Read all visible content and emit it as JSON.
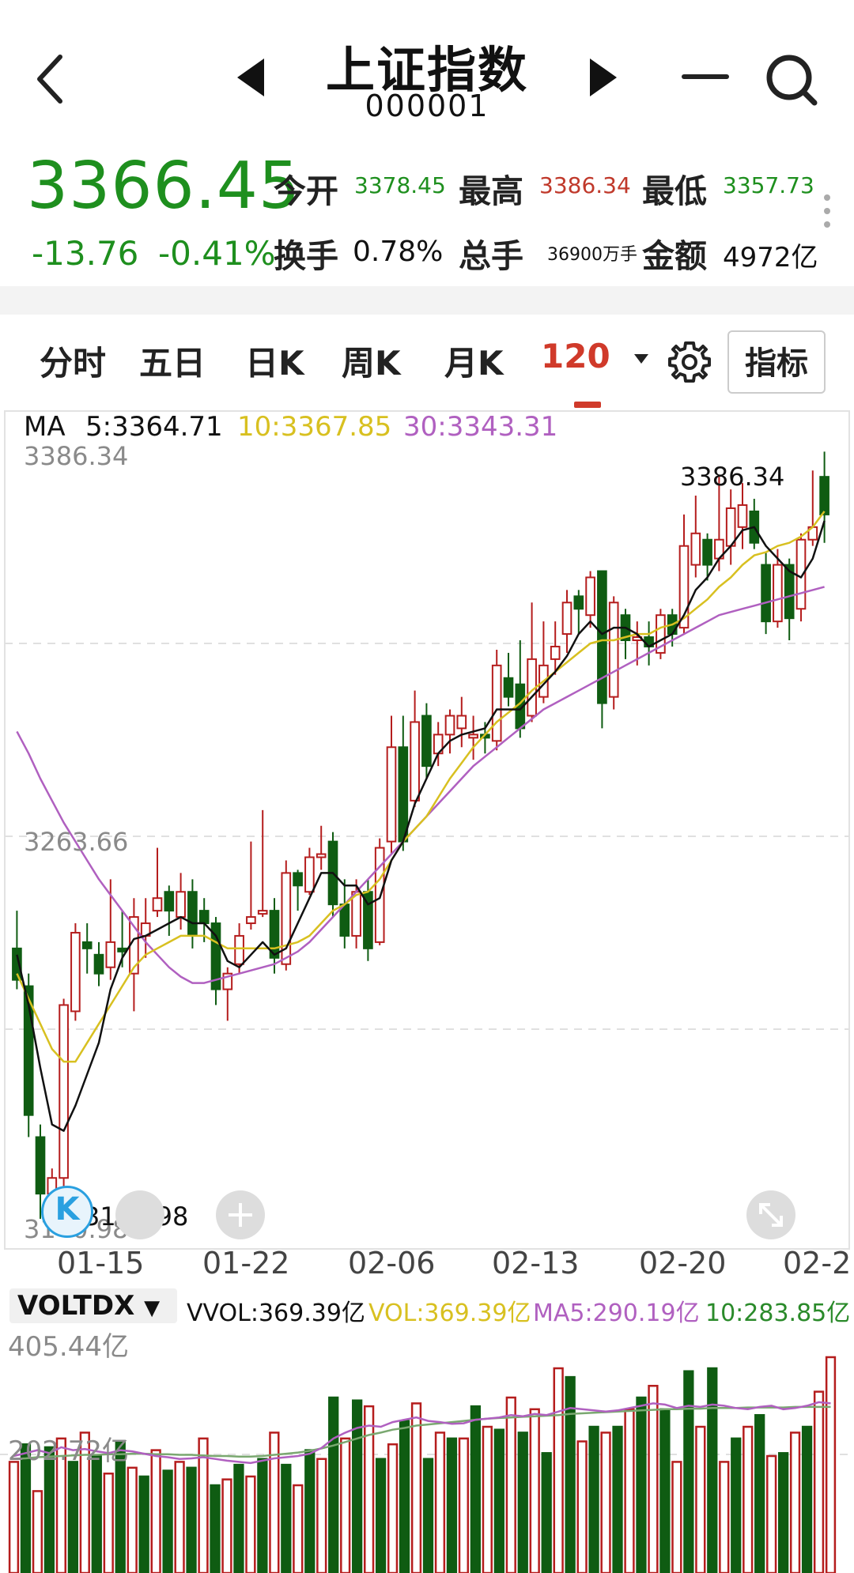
{
  "header": {
    "title": "上证指数",
    "code": "000001"
  },
  "quote": {
    "price": "3366.45",
    "change": "-13.76",
    "change_pct": "-0.41%",
    "open_label": "今开",
    "open": "3378.45",
    "high_label": "最高",
    "high": "3386.34",
    "low_label": "最低",
    "low": "3357.73",
    "turnover_label": "换手",
    "turnover": "0.78%",
    "volume_label": "总手",
    "volume": "36900万手",
    "amount_label": "金额",
    "amount": "4972亿"
  },
  "tabs": [
    "分时",
    "五日",
    "日K",
    "周K",
    "月K",
    "120"
  ],
  "active_tab": 5,
  "indicator_button": "指标",
  "ma": {
    "label": "MA",
    "ma5": "5:3364.71",
    "ma10": "10:3367.85",
    "ma30": "30:3343.31"
  },
  "price_axis": {
    "top": "3386.34",
    "mid": "3263.66",
    "bottom": "3140.98"
  },
  "annotations": {
    "high": "3386.34",
    "low": "3140.98"
  },
  "date_labels": [
    "01-15",
    "01-22",
    "02-06",
    "02-13",
    "02-20",
    "02-2"
  ],
  "volume_panel": {
    "indicator": "VOLTDX",
    "vvol": "VVOL:369.39亿",
    "vol": "VOL:369.39亿",
    "ma5": "MA5:290.19亿",
    "ma10": "10:283.85亿",
    "axis_top": "405.44亿",
    "axis_mid": "202.72亿"
  },
  "colors": {
    "up": "#b51d1d",
    "down": "#0f5c12",
    "ma5": "#111111",
    "ma10": "#d8c020",
    "ma30": "#b060c0",
    "accent": "#d03a2a",
    "price_green": "#1e8f1e"
  },
  "chart_data": {
    "type": "candlestick",
    "ylim": [
      3140.98,
      3386.34
    ],
    "candles": [
      [
        3228,
        3218,
        3240,
        3215
      ],
      [
        3216,
        3175,
        3220,
        3168
      ],
      [
        3168,
        3150,
        3172,
        3142
      ],
      [
        3150,
        3155,
        3158,
        3141
      ],
      [
        3155,
        3210,
        3212,
        3150
      ],
      [
        3208,
        3233,
        3236,
        3205
      ],
      [
        3230,
        3228,
        3236,
        3220
      ],
      [
        3226,
        3220,
        3230,
        3216
      ],
      [
        3222,
        3230,
        3250,
        3218
      ],
      [
        3228,
        3227,
        3240,
        3222
      ],
      [
        3220,
        3238,
        3244,
        3208
      ],
      [
        3232,
        3236,
        3244,
        3225
      ],
      [
        3240,
        3244,
        3260,
        3238
      ],
      [
        3246,
        3240,
        3248,
        3232
      ],
      [
        3238,
        3246,
        3252,
        3234
      ],
      [
        3246,
        3232,
        3250,
        3228
      ],
      [
        3240,
        3236,
        3244,
        3230
      ],
      [
        3236,
        3215,
        3238,
        3210
      ],
      [
        3215,
        3220,
        3222,
        3205
      ],
      [
        3223,
        3232,
        3236,
        3220
      ],
      [
        3236,
        3238,
        3262,
        3234
      ],
      [
        3239,
        3240,
        3272,
        3238
      ],
      [
        3240,
        3225,
        3244,
        3220
      ],
      [
        3223,
        3252,
        3256,
        3221
      ],
      [
        3252,
        3248,
        3253,
        3240
      ],
      [
        3246,
        3257,
        3260,
        3245
      ],
      [
        3257,
        3258,
        3267,
        3253
      ],
      [
        3262,
        3242,
        3265,
        3238
      ],
      [
        3242,
        3232,
        3250,
        3228
      ],
      [
        3232,
        3246,
        3250,
        3228
      ],
      [
        3246,
        3228,
        3250,
        3224
      ],
      [
        3230,
        3260,
        3263,
        3229
      ],
      [
        3262,
        3292,
        3302,
        3258
      ],
      [
        3292,
        3262,
        3302,
        3259
      ],
      [
        3275,
        3300,
        3310,
        3273
      ],
      [
        3302,
        3286,
        3306,
        3282
      ],
      [
        3290,
        3296,
        3300,
        3286
      ],
      [
        3296,
        3302,
        3304,
        3290
      ],
      [
        3298,
        3302,
        3308,
        3292
      ],
      [
        3295,
        3296,
        3302,
        3288
      ],
      [
        3296,
        3295,
        3300,
        3290
      ],
      [
        3294,
        3318,
        3323,
        3291
      ],
      [
        3314,
        3308,
        3322,
        3305
      ],
      [
        3312,
        3298,
        3326,
        3295
      ],
      [
        3302,
        3320,
        3338,
        3300
      ],
      [
        3308,
        3318,
        3332,
        3306
      ],
      [
        3320,
        3324,
        3332,
        3315
      ],
      [
        3328,
        3338,
        3342,
        3322
      ],
      [
        3340,
        3336,
        3342,
        3328
      ],
      [
        3334,
        3346,
        3348,
        3330
      ],
      [
        3348,
        3306,
        3348,
        3298
      ],
      [
        3308,
        3338,
        3340,
        3304
      ],
      [
        3334,
        3326,
        3336,
        3320
      ],
      [
        3326,
        3327,
        3332,
        3318
      ],
      [
        3327,
        3324,
        3332,
        3318
      ],
      [
        3322,
        3334,
        3336,
        3320
      ],
      [
        3334,
        3328,
        3336,
        3324
      ],
      [
        3330,
        3356,
        3366,
        3328
      ],
      [
        3350,
        3360,
        3372,
        3346
      ],
      [
        3358,
        3350,
        3360,
        3345
      ],
      [
        3352,
        3358,
        3378,
        3348
      ],
      [
        3356,
        3368,
        3374,
        3350
      ],
      [
        3362,
        3369,
        3376,
        3355
      ],
      [
        3367,
        3357,
        3371,
        3355
      ],
      [
        3350,
        3332,
        3354,
        3328
      ],
      [
        3332,
        3350,
        3355,
        3330
      ],
      [
        3350,
        3333,
        3352,
        3326
      ],
      [
        3336,
        3358,
        3360,
        3332
      ],
      [
        3358,
        3362,
        3380,
        3356
      ],
      [
        3378,
        3366,
        3386,
        3357
      ]
    ],
    "ma5": [
      3226,
      3210,
      3190,
      3172,
      3170,
      3178,
      3188,
      3198,
      3215,
      3225,
      3231,
      3232,
      3234,
      3236,
      3238,
      3236,
      3236,
      3232,
      3224,
      3222,
      3226,
      3230,
      3226,
      3228,
      3236,
      3244,
      3252,
      3252,
      3248,
      3248,
      3242,
      3244,
      3256,
      3262,
      3274,
      3282,
      3290,
      3294,
      3296,
      3297,
      3298,
      3304,
      3304,
      3304,
      3308,
      3312,
      3316,
      3321,
      3328,
      3332,
      3328,
      3330,
      3330,
      3328,
      3324,
      3326,
      3328,
      3334,
      3342,
      3346,
      3352,
      3356,
      3361,
      3362,
      3356,
      3352,
      3348,
      3346,
      3352,
      3364
    ],
    "ma10": [
      3220,
      3212,
      3204,
      3196,
      3192,
      3192,
      3198,
      3204,
      3210,
      3216,
      3222,
      3226,
      3228,
      3230,
      3232,
      3232,
      3232,
      3230,
      3228,
      3228,
      3228,
      3228,
      3228,
      3229,
      3230,
      3232,
      3236,
      3240,
      3242,
      3245,
      3246,
      3250,
      3256,
      3262,
      3266,
      3270,
      3276,
      3282,
      3287,
      3292,
      3296,
      3300,
      3303,
      3306,
      3310,
      3313,
      3316,
      3319,
      3322,
      3325,
      3326,
      3326,
      3327,
      3328,
      3328,
      3330,
      3331,
      3333,
      3336,
      3339,
      3343,
      3346,
      3350,
      3353,
      3354,
      3356,
      3357,
      3359,
      3362,
      3367
    ],
    "ma30": [
      3297,
      3290,
      3282,
      3275,
      3268,
      3262,
      3256,
      3250,
      3245,
      3240,
      3235,
      3230,
      3226,
      3222,
      3219,
      3217,
      3217,
      3218,
      3219,
      3220,
      3221,
      3222,
      3223,
      3225,
      3227,
      3230,
      3234,
      3238,
      3242,
      3246,
      3250,
      3254,
      3258,
      3262,
      3266,
      3270,
      3274,
      3278,
      3282,
      3286,
      3289,
      3292,
      3295,
      3298,
      3301,
      3304,
      3306,
      3308,
      3310,
      3312,
      3314,
      3316,
      3318,
      3320,
      3322,
      3324,
      3326,
      3328,
      3330,
      3332,
      3334,
      3335,
      3336,
      3337,
      3338,
      3339,
      3340,
      3341,
      3342,
      3343
    ],
    "volume": [
      [
        190,
        1
      ],
      [
        220,
        0
      ],
      [
        140,
        1
      ],
      [
        215,
        0
      ],
      [
        230,
        1
      ],
      [
        190,
        0
      ],
      [
        240,
        1
      ],
      [
        200,
        0
      ],
      [
        170,
        1
      ],
      [
        225,
        0
      ],
      [
        180,
        1
      ],
      [
        165,
        0
      ],
      [
        210,
        1
      ],
      [
        175,
        0
      ],
      [
        190,
        1
      ],
      [
        180,
        0
      ],
      [
        230,
        1
      ],
      [
        150,
        0
      ],
      [
        160,
        1
      ],
      [
        185,
        0
      ],
      [
        165,
        1
      ],
      [
        195,
        0
      ],
      [
        240,
        1
      ],
      [
        185,
        0
      ],
      [
        150,
        1
      ],
      [
        210,
        0
      ],
      [
        195,
        1
      ],
      [
        300,
        0
      ],
      [
        230,
        1
      ],
      [
        295,
        0
      ],
      [
        285,
        1
      ],
      [
        195,
        0
      ],
      [
        220,
        1
      ],
      [
        260,
        0
      ],
      [
        290,
        1
      ],
      [
        195,
        0
      ],
      [
        240,
        1
      ],
      [
        230,
        0
      ],
      [
        230,
        1
      ],
      [
        285,
        0
      ],
      [
        250,
        1
      ],
      [
        245,
        0
      ],
      [
        300,
        1
      ],
      [
        240,
        0
      ],
      [
        280,
        1
      ],
      [
        205,
        0
      ],
      [
        350,
        1
      ],
      [
        335,
        0
      ],
      [
        225,
        1
      ],
      [
        250,
        0
      ],
      [
        240,
        1
      ],
      [
        250,
        0
      ],
      [
        280,
        1
      ],
      [
        300,
        0
      ],
      [
        320,
        1
      ],
      [
        280,
        0
      ],
      [
        190,
        1
      ],
      [
        345,
        0
      ],
      [
        250,
        1
      ],
      [
        350,
        0
      ],
      [
        190,
        1
      ],
      [
        230,
        0
      ],
      [
        250,
        1
      ],
      [
        270,
        0
      ],
      [
        200,
        1
      ],
      [
        205,
        0
      ],
      [
        240,
        1
      ],
      [
        250,
        0
      ],
      [
        310,
        1
      ],
      [
        369,
        1
      ]
    ],
    "volume_ma5": [
      200,
      205,
      210,
      205,
      215,
      210,
      212,
      208,
      205,
      210,
      208,
      204,
      200,
      198,
      195,
      196,
      198,
      195,
      192,
      190,
      188,
      192,
      196,
      198,
      200,
      204,
      214,
      230,
      240,
      248,
      252,
      250,
      258,
      262,
      266,
      260,
      258,
      255,
      256,
      262,
      264,
      266,
      270,
      268,
      272,
      270,
      276,
      282,
      280,
      278,
      276,
      278,
      282,
      286,
      290,
      288,
      282,
      286,
      284,
      288,
      286,
      282,
      280,
      284,
      286,
      280,
      282,
      286,
      292,
      290
    ],
    "volume_ma10": [
      195,
      196,
      198,
      199,
      200,
      201,
      202,
      202,
      203,
      203,
      204,
      204,
      203,
      203,
      202,
      202,
      201,
      200,
      200,
      199,
      199,
      200,
      202,
      204,
      206,
      209,
      213,
      218,
      224,
      230,
      236,
      240,
      245,
      248,
      252,
      254,
      256,
      258,
      260,
      262,
      264,
      265,
      266,
      267,
      268,
      269,
      270,
      272,
      273,
      274,
      275,
      276,
      277,
      278,
      279,
      280,
      280,
      281,
      281,
      282,
      282,
      282,
      283,
      283,
      283,
      283,
      284,
      284,
      284,
      284
    ]
  }
}
